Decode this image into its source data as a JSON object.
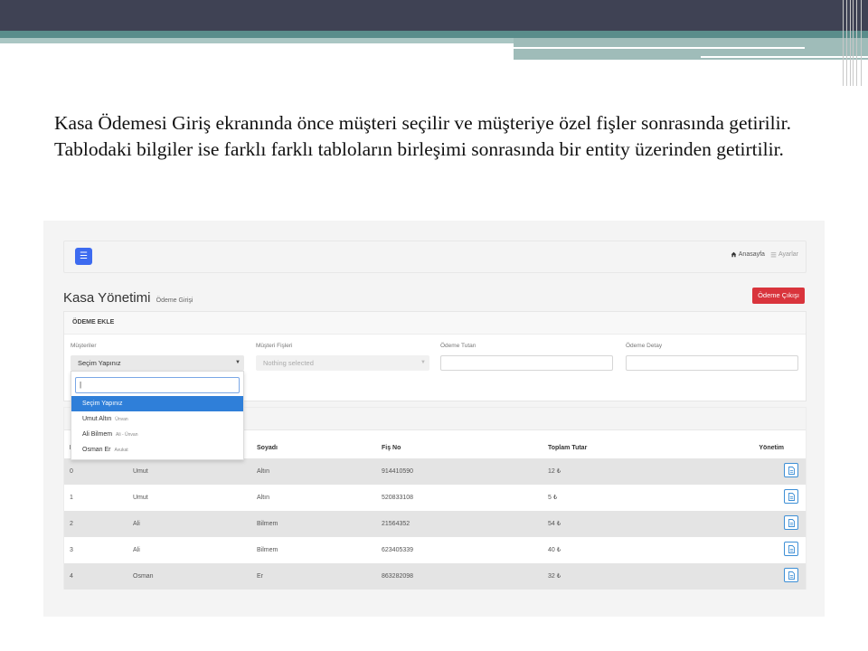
{
  "slide": {
    "text": "Kasa Ödemesi Giriş ekranında önce müşteri seçilir ve müşteriye özel fişler sonrasında getirilir. Tablodaki bilgiler ise farklı farklı tabloların birleşimi sonrasında bir entity üzerinden getirtilir."
  },
  "nav": {
    "menu_icon": "bars-icon",
    "home_label": "Anasayfa",
    "settings_label": "Ayarlar"
  },
  "page": {
    "title": "Kasa Yönetimi",
    "subtitle": "Ödeme Girişi",
    "exit_button": "Ödeme Çıkışı"
  },
  "form": {
    "header": "ÖDEME EKLE",
    "customer_label": "Müşteriler",
    "customer_value": "Seçim Yapınız",
    "receipt_label": "Müşteri Fişleri",
    "receipt_value": "Nothing selected",
    "amount_label": "Ödeme Tutarı",
    "detail_label": "Ödeme Detay"
  },
  "dropdown": {
    "search_value": "|",
    "items": [
      {
        "name": "Seçim Yapınız",
        "sub": ""
      },
      {
        "name": "Umut Altın",
        "sub": "Ünvan"
      },
      {
        "name": "Ali Bilmem",
        "sub": "Ali - Ünvan"
      },
      {
        "name": "Osman Er",
        "sub": "Avukat"
      }
    ]
  },
  "table": {
    "headers": [
      "I",
      "",
      "Soyadı",
      "Fiş No",
      "Toplam Tutar",
      "Yönetim"
    ],
    "rows": [
      [
        "0",
        "Umut",
        "Altın",
        "914410590",
        "12 ₺"
      ],
      [
        "1",
        "Umut",
        "Altın",
        "520833108",
        "5 ₺"
      ],
      [
        "2",
        "Ali",
        "Bilmem",
        "21564352",
        "54 ₺"
      ],
      [
        "3",
        "Ali",
        "Bilmem",
        "623405339",
        "40 ₺"
      ],
      [
        "4",
        "Osman",
        "Er",
        "863282098",
        "32 ₺"
      ]
    ]
  },
  "colors": {
    "primary": "#3d6bf0",
    "danger": "#d9343c",
    "selected": "#2f7fd9"
  }
}
